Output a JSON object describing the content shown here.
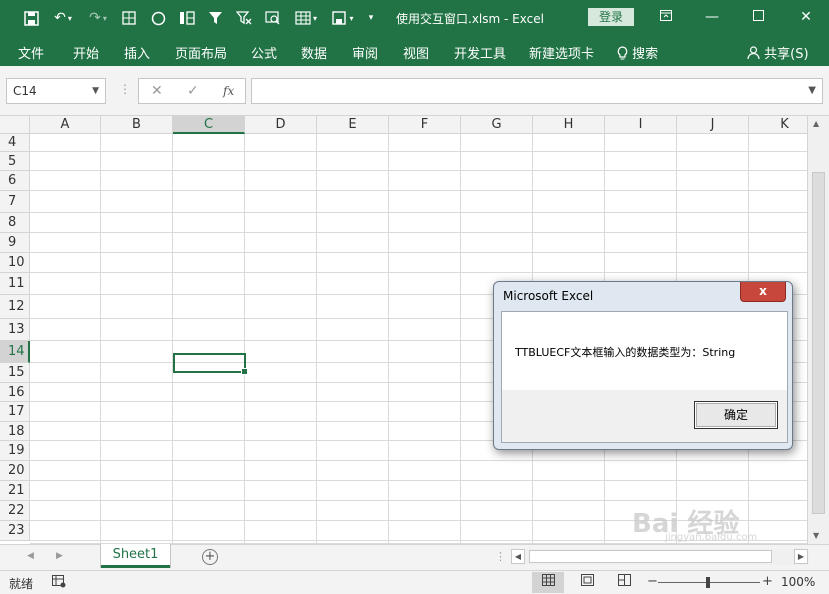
{
  "app": {
    "title": "使用交互窗口.xlsm  -  Excel",
    "login_label": "登录",
    "share_label": "共享(S)",
    "search_label": "搜索"
  },
  "quick_access": [
    "save-icon",
    "undo-icon",
    "redo-icon",
    "borders-icon",
    "shape-circle-icon",
    "freeze-panes-icon",
    "filter-icon",
    "clear-filter-icon",
    "find-icon",
    "table-format-icon",
    "save-as-icon",
    "customize-icon"
  ],
  "ribbon_tabs": [
    "文件",
    "开始",
    "插入",
    "页面布局",
    "公式",
    "数据",
    "审阅",
    "视图",
    "开发工具",
    "新建选项卡"
  ],
  "name_box": "C14",
  "formula_bar": {
    "fx_label": "fx",
    "cancel_glyph": "✕",
    "enter_glyph": "✓",
    "value": ""
  },
  "columns": [
    "A",
    "B",
    "C",
    "D",
    "E",
    "F",
    "G",
    "H",
    "I",
    "J",
    "K"
  ],
  "selected_column": "C",
  "rows": [
    "4",
    "5",
    "6",
    "7",
    "8",
    "9",
    "10",
    "11",
    "12",
    "13",
    "14",
    "15",
    "16",
    "17",
    "18",
    "19",
    "20",
    "21",
    "22",
    "23"
  ],
  "selected_row": "14",
  "active_cell": "C14",
  "sheet_tabs": [
    "Sheet1"
  ],
  "status": {
    "ready": "就绪",
    "zoom": "100%"
  },
  "dialog": {
    "title": "Microsoft Excel",
    "close_glyph": "x",
    "message": "TTBLUECF文本框输入的数据类型为：String",
    "ok_label": "确定"
  },
  "watermark": {
    "brand": "Bai 经验",
    "url": "jingyan.baidu.com"
  }
}
